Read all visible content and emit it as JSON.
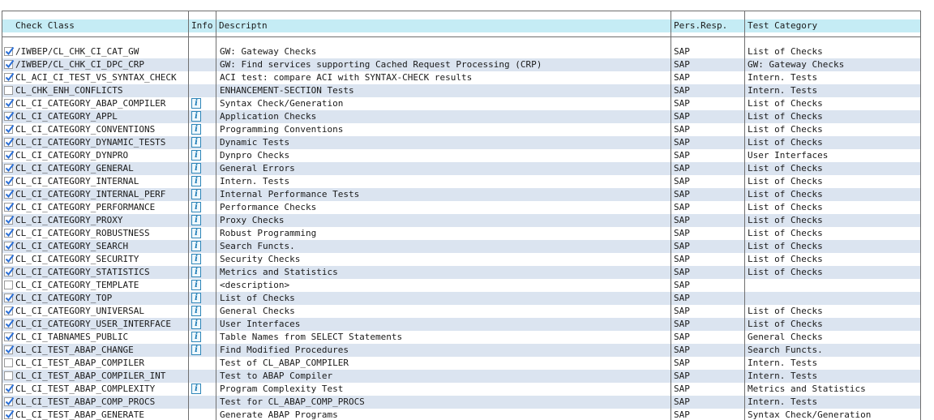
{
  "columns": {
    "check_class": "Check Class",
    "info": "Info",
    "description": "Descriptn",
    "pers_resp": "Pers.Resp.",
    "test_category": "Test Category"
  },
  "rows": [
    {
      "checked": true,
      "info": false,
      "name": "/IWBEP/CL_CHK_CI_CAT_GW",
      "description": "GW: Gateway Checks",
      "resp": "SAP",
      "category": "List of Checks"
    },
    {
      "checked": true,
      "info": false,
      "name": "/IWBEP/CL_CHK_CI_DPC_CRP",
      "description": "GW: Find services supporting Cached Request Processing (CRP)",
      "resp": "SAP",
      "category": "GW: Gateway Checks"
    },
    {
      "checked": true,
      "info": false,
      "name": "CL_ACI_CI_TEST_VS_SYNTAX_CHECK",
      "description": "ACI test: compare ACI with SYNTAX-CHECK results",
      "resp": "SAP",
      "category": "Intern. Tests"
    },
    {
      "checked": false,
      "info": false,
      "name": "CL_CHK_ENH_CONFLICTS",
      "description": "ENHANCEMENT-SECTION Tests",
      "resp": "SAP",
      "category": "Intern. Tests"
    },
    {
      "checked": true,
      "info": true,
      "name": "CL_CI_CATEGORY_ABAP_COMPILER",
      "description": "Syntax Check/Generation",
      "resp": "SAP",
      "category": "List of Checks"
    },
    {
      "checked": true,
      "info": true,
      "name": "CL_CI_CATEGORY_APPL",
      "description": "Application Checks",
      "resp": "SAP",
      "category": "List of Checks"
    },
    {
      "checked": true,
      "info": true,
      "name": "CL_CI_CATEGORY_CONVENTIONS",
      "description": "Programming Conventions",
      "resp": "SAP",
      "category": "List of Checks"
    },
    {
      "checked": true,
      "info": true,
      "name": "CL_CI_CATEGORY_DYNAMIC_TESTS",
      "description": "Dynamic Tests",
      "resp": "SAP",
      "category": "List of Checks"
    },
    {
      "checked": true,
      "info": true,
      "name": "CL_CI_CATEGORY_DYNPRO",
      "description": "Dynpro Checks",
      "resp": "SAP",
      "category": "User Interfaces"
    },
    {
      "checked": true,
      "info": true,
      "name": "CL_CI_CATEGORY_GENERAL",
      "description": "General Errors",
      "resp": "SAP",
      "category": "List of Checks"
    },
    {
      "checked": true,
      "info": true,
      "name": "CL_CI_CATEGORY_INTERNAL",
      "description": "Intern. Tests",
      "resp": "SAP",
      "category": "List of Checks"
    },
    {
      "checked": true,
      "info": true,
      "name": "CL_CI_CATEGORY_INTERNAL_PERF",
      "description": "Internal Performance Tests",
      "resp": "SAP",
      "category": "List of Checks"
    },
    {
      "checked": true,
      "info": true,
      "name": "CL_CI_CATEGORY_PERFORMANCE",
      "description": "Performance Checks",
      "resp": "SAP",
      "category": "List of Checks"
    },
    {
      "checked": true,
      "info": true,
      "name": "CL_CI_CATEGORY_PROXY",
      "description": "Proxy Checks",
      "resp": "SAP",
      "category": "List of Checks"
    },
    {
      "checked": true,
      "info": true,
      "name": "CL_CI_CATEGORY_ROBUSTNESS",
      "description": "Robust Programming",
      "resp": "SAP",
      "category": "List of Checks"
    },
    {
      "checked": true,
      "info": true,
      "name": "CL_CI_CATEGORY_SEARCH",
      "description": "Search Functs.",
      "resp": "SAP",
      "category": "List of Checks"
    },
    {
      "checked": true,
      "info": true,
      "name": "CL_CI_CATEGORY_SECURITY",
      "description": "Security Checks",
      "resp": "SAP",
      "category": "List of Checks"
    },
    {
      "checked": true,
      "info": true,
      "name": "CL_CI_CATEGORY_STATISTICS",
      "description": "Metrics and Statistics",
      "resp": "SAP",
      "category": "List of Checks"
    },
    {
      "checked": false,
      "info": true,
      "name": "CL_CI_CATEGORY_TEMPLATE",
      "description": "<description>",
      "resp": "SAP",
      "category": ""
    },
    {
      "checked": true,
      "info": true,
      "name": "CL_CI_CATEGORY_TOP",
      "description": "List of Checks",
      "resp": "SAP",
      "category": ""
    },
    {
      "checked": true,
      "info": true,
      "name": "CL_CI_CATEGORY_UNIVERSAL",
      "description": "General Checks",
      "resp": "SAP",
      "category": "List of Checks"
    },
    {
      "checked": true,
      "info": true,
      "name": "CL_CI_CATEGORY_USER_INTERFACE",
      "description": "User Interfaces",
      "resp": "SAP",
      "category": "List of Checks"
    },
    {
      "checked": true,
      "info": true,
      "name": "CL_CI_TABNAMES_PUBLIC",
      "description": "Table Names from SELECT Statements",
      "resp": "SAP",
      "category": "General Checks"
    },
    {
      "checked": true,
      "info": true,
      "name": "CL_CI_TEST_ABAP_CHANGE",
      "description": "Find Modified Procedures",
      "resp": "SAP",
      "category": "Search Functs."
    },
    {
      "checked": false,
      "info": false,
      "name": "CL_CI_TEST_ABAP_COMPILER",
      "description": "Test of CL_ABAP_COMPILER",
      "resp": "SAP",
      "category": "Intern. Tests"
    },
    {
      "checked": false,
      "info": false,
      "name": "CL_CI_TEST_ABAP_COMPILER_INT",
      "description": "Test to ABAP Compiler",
      "resp": "SAP",
      "category": "Intern. Tests"
    },
    {
      "checked": true,
      "info": true,
      "name": "CL_CI_TEST_ABAP_COMPLEXITY",
      "description": "Program Complexity Test",
      "resp": "SAP",
      "category": "Metrics and Statistics"
    },
    {
      "checked": true,
      "info": false,
      "name": "CL_CI_TEST_ABAP_COMP_PROCS",
      "description": "Test for CL_ABAP_COMP_PROCS",
      "resp": "SAP",
      "category": "Intern. Tests"
    },
    {
      "checked": true,
      "info": false,
      "name": "CL_CI_TEST_ABAP_GENERATE",
      "description": "Generate ABAP Programs",
      "resp": "SAP",
      "category": "Syntax Check/Generation"
    }
  ],
  "info_glyph": "i",
  "colors": {
    "header_bg": "#c5ecf5",
    "alt_row_bg": "#dbe4f0",
    "check_mark": "#2b6fd6",
    "info_icon": "#1d7bb5"
  }
}
